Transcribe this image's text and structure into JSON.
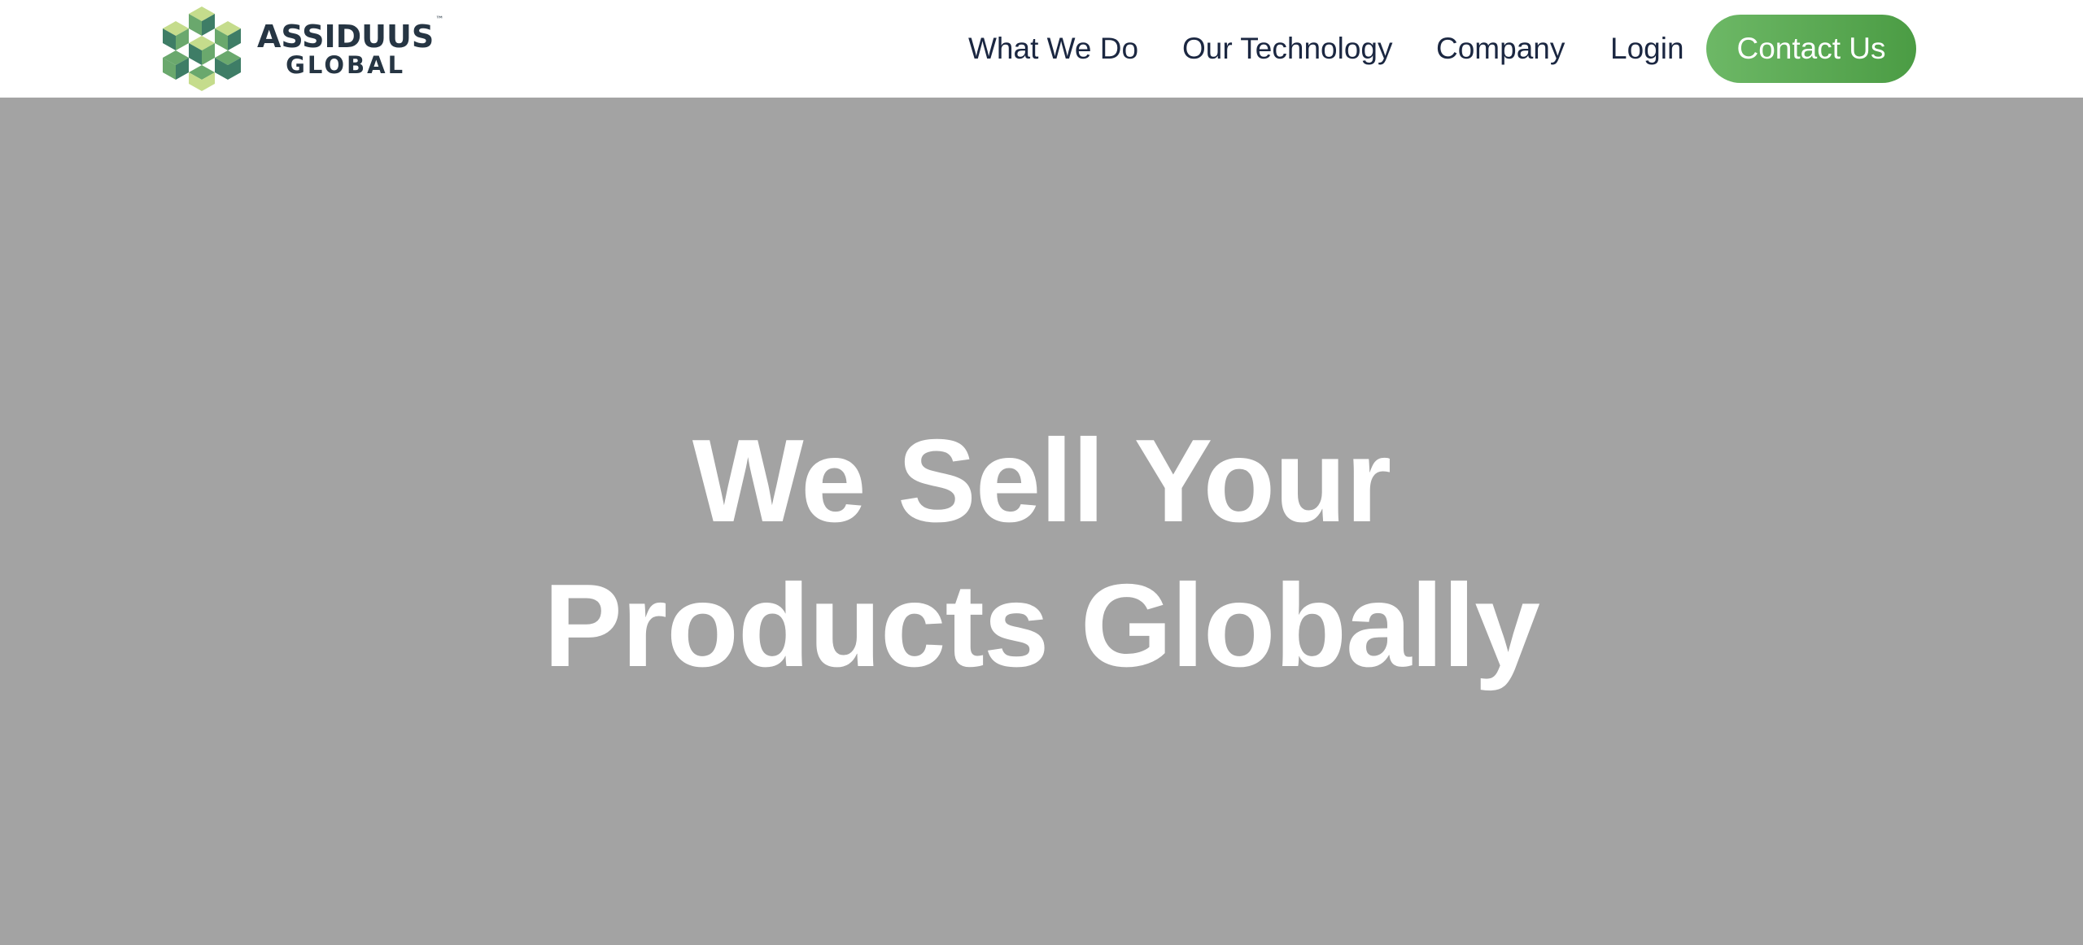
{
  "header": {
    "logo": {
      "line1": "ASSIDUUS",
      "line2": "GLOBAL",
      "tm": "™",
      "colors": {
        "dark_green": "#3e7d66",
        "mid_green": "#6aa86d",
        "light_green": "#c5dc8c",
        "text": "#263543"
      }
    },
    "nav": {
      "items": [
        {
          "label": "What We Do"
        },
        {
          "label": "Our Technology"
        },
        {
          "label": "Company"
        },
        {
          "label": "Login"
        }
      ],
      "cta_label": "Contact Us",
      "cta_color": "#5aab52"
    }
  },
  "hero": {
    "title_line1": "We Sell Your",
    "title_line2": "Products Globally",
    "background": "#a3a3a3"
  }
}
